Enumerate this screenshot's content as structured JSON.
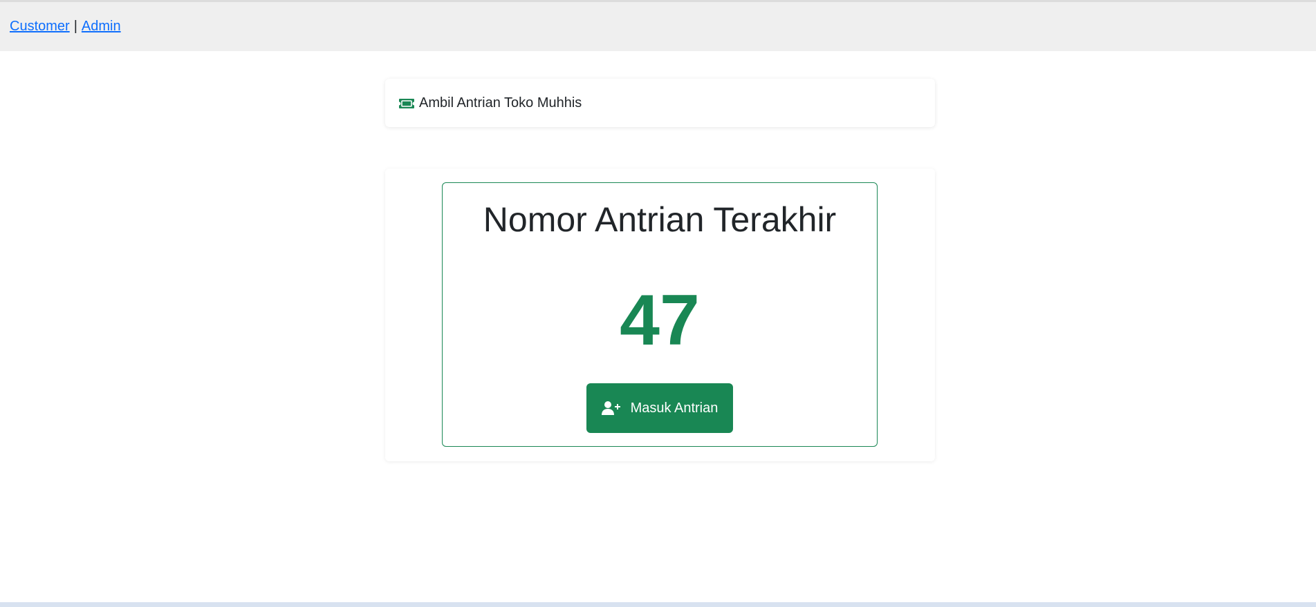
{
  "nav": {
    "customer_link": "Customer",
    "separator": "|",
    "admin_link": "Admin"
  },
  "header": {
    "icon": "ticket-icon",
    "title": "Ambil Antrian Toko Muhhis"
  },
  "queue": {
    "title": "Nomor Antrian Terakhir",
    "last_number": "47",
    "join_button_label": "Masuk Antrian",
    "join_button_icon": "user-plus-icon"
  },
  "colors": {
    "accent": "#198754",
    "link": "#0d6efd",
    "navbar_bg": "#efefef"
  }
}
